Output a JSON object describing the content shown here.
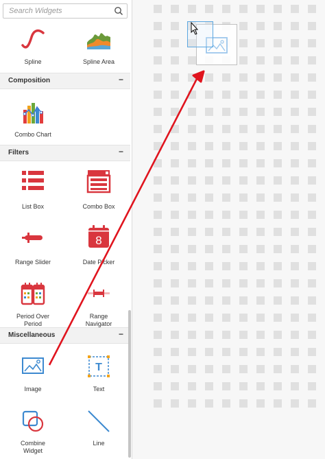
{
  "search": {
    "placeholder": "Search Widgets"
  },
  "charts": [
    {
      "label": "Spline",
      "icon": "spline-icon"
    },
    {
      "label": "Spline Area",
      "icon": "spline-area-icon"
    }
  ],
  "sections": {
    "composition": {
      "title": "Composition",
      "toggle": "−",
      "items": [
        {
          "label": "Combo Chart",
          "icon": "combo-chart-icon"
        }
      ]
    },
    "filters": {
      "title": "Filters",
      "toggle": "−",
      "items": [
        {
          "label": "List Box",
          "icon": "list-box-icon"
        },
        {
          "label": "Combo Box",
          "icon": "combo-box-icon"
        },
        {
          "label": "Range Slider",
          "icon": "range-slider-icon"
        },
        {
          "label": "Date Picker",
          "icon": "date-picker-icon",
          "day": "8"
        },
        {
          "label_line1": "Period Over",
          "label_line2": "Period",
          "icon": "period-over-period-icon"
        },
        {
          "label_line1": "Range",
          "label_line2": "Navigator",
          "icon": "range-navigator-icon"
        }
      ]
    },
    "miscellaneous": {
      "title": "Miscellaneous",
      "toggle": "−",
      "items": [
        {
          "label": "Image",
          "icon": "image-icon"
        },
        {
          "label": "Text",
          "icon": "text-icon",
          "glyph": "T"
        },
        {
          "label_line1": "Combine",
          "label_line2": "Widget",
          "icon": "combine-widget-icon"
        },
        {
          "label": "Line",
          "icon": "line-icon"
        }
      ]
    }
  },
  "colors": {
    "accent_red": "#d9363e",
    "accent_blue": "#4a90d9",
    "drag_arrow": "#e0141e",
    "canvas_bg": "#f7f7f7",
    "grid_dot": "#e0e0e0"
  }
}
